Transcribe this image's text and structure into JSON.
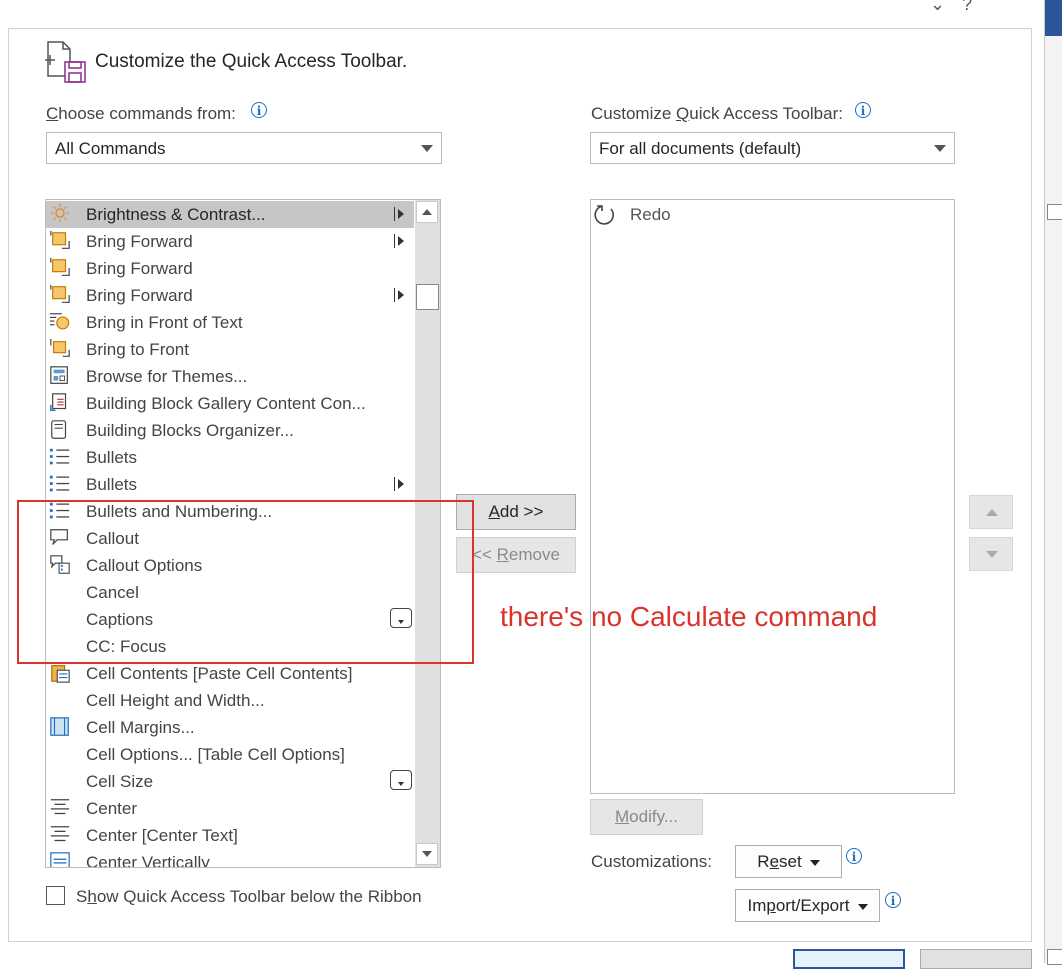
{
  "window": {
    "top_right_glyphs": "⌄ ?"
  },
  "header": {
    "title": "Customize the Quick Access Toolbar."
  },
  "left": {
    "choose_label_first": "C",
    "choose_label_rest": "hoose commands from:",
    "source_dropdown_value": "All Commands",
    "commands": [
      {
        "label": "Brightness & Contrast...",
        "icon": "brightness-icon",
        "submenu": true,
        "selected": true
      },
      {
        "label": "Bring Forward",
        "icon": "bring-forward-icon",
        "submenu": true
      },
      {
        "label": "Bring Forward",
        "icon": "bring-forward-icon"
      },
      {
        "label": "Bring Forward",
        "icon": "bring-forward-icon",
        "submenu": true
      },
      {
        "label": "Bring in Front of Text",
        "icon": "bring-in-front-of-text-icon"
      },
      {
        "label": "Bring to Front",
        "icon": "bring-to-front-icon"
      },
      {
        "label": "Browse for Themes...",
        "icon": "browse-themes-icon"
      },
      {
        "label": "Building Block Gallery Content Con...",
        "icon": "building-block-gallery-icon"
      },
      {
        "label": "Building Blocks Organizer...",
        "icon": "building-blocks-organizer-icon"
      },
      {
        "label": "Bullets",
        "icon": "bullets-icon"
      },
      {
        "label": "Bullets",
        "icon": "bullets-icon",
        "submenu": true
      },
      {
        "label": "Bullets and Numbering...",
        "icon": "bullets-icon"
      },
      {
        "label": "Callout",
        "icon": "callout-icon"
      },
      {
        "label": "Callout Options",
        "icon": "callout-options-icon"
      },
      {
        "label": "Cancel",
        "icon": ""
      },
      {
        "label": "Captions",
        "icon": "",
        "combo": true
      },
      {
        "label": "CC: Focus",
        "icon": ""
      },
      {
        "label": "Cell Contents [Paste Cell Contents]",
        "icon": "paste-cell-contents-icon"
      },
      {
        "label": "Cell Height and Width...",
        "icon": ""
      },
      {
        "label": "Cell Margins...",
        "icon": "cell-margins-icon"
      },
      {
        "label": "Cell Options... [Table Cell Options]",
        "icon": ""
      },
      {
        "label": "Cell Size",
        "icon": "",
        "combo": true
      },
      {
        "label": "Center",
        "icon": "align-center-icon"
      },
      {
        "label": "Center [Center Text]",
        "icon": "align-center-icon"
      },
      {
        "label": "Center Vertically",
        "icon": "center-vertically-icon"
      }
    ],
    "show_below_ribbon_pre": "S",
    "show_below_ribbon_u": "h",
    "show_below_ribbon_post": "ow Quick Access Toolbar below the Ribbon"
  },
  "middle": {
    "add_u": "A",
    "add_rest": "dd >>",
    "remove_pre": "<< ",
    "remove_u": "R",
    "remove_rest": "emove"
  },
  "right": {
    "customize_label_pre": "Customize ",
    "customize_label_u": "Q",
    "customize_label_rest": "uick Access Toolbar:",
    "target_dropdown_value": "For all documents (default)",
    "qat_items": [
      {
        "label": "Redo",
        "icon": "redo-icon"
      }
    ],
    "modify_u": "M",
    "modify_rest": "odify...",
    "customizations_label": "Customizations:",
    "reset_pre": "R",
    "reset_u": "e",
    "reset_rest": "set",
    "import_pre": "Im",
    "import_u": "p",
    "import_rest": "ort/Export"
  },
  "annotation": {
    "text": "there's no Calculate command",
    "color": "#d9342b"
  },
  "colors": {
    "accent": "#2b579a",
    "info": "#1b6ec2",
    "selected_row": "#c6c6c6"
  }
}
